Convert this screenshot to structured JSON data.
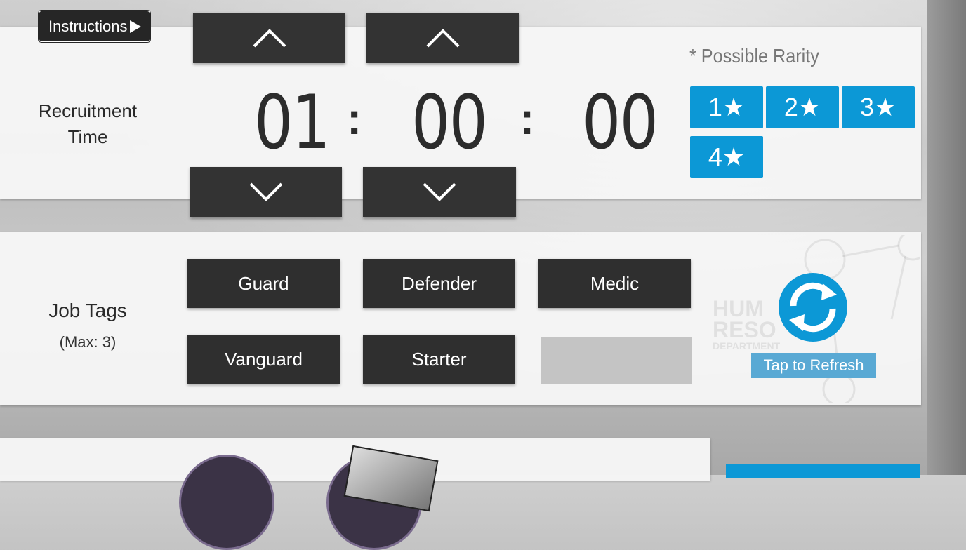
{
  "instructions": {
    "label": "Instructions"
  },
  "recruitment_time": {
    "label_line1": "Recruitment",
    "label_line2": "Time",
    "hours": "01",
    "minutes": "00",
    "seconds": "00",
    "separator": ":",
    "icons": {
      "up": "chevron-up-icon",
      "down": "chevron-down-icon"
    }
  },
  "rarity": {
    "title": "* Possible Rarity",
    "options": [
      "1★",
      "2★",
      "3★",
      "4★"
    ],
    "color": "#0c98d6"
  },
  "job_tags": {
    "label": "Job Tags",
    "sub_label": "(Max: 3)",
    "tags": [
      "Guard",
      "Defender",
      "Medic",
      "Vanguard",
      "Starter"
    ]
  },
  "refresh": {
    "label": "Tap to Refresh",
    "icon": "refresh-icon"
  },
  "watermark": {
    "line1": "HUM",
    "line2": "RESO",
    "line3": "DEPARTMENT"
  }
}
